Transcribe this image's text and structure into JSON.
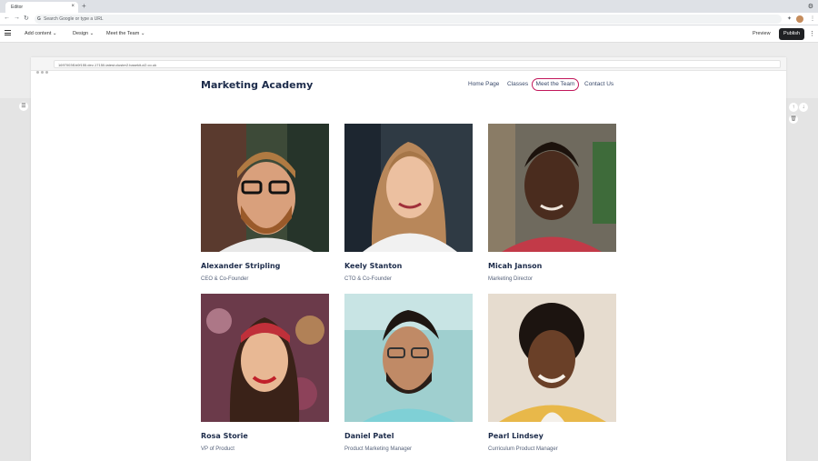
{
  "browser": {
    "tab_title": "Editor",
    "tab_close": "×",
    "new_tab": "+",
    "omnibox_placeholder": "Search Google or type a URL"
  },
  "editor": {
    "menus": [
      "Add content",
      "Design",
      "Meet the Team"
    ],
    "preview_label": "Preview",
    "publish_label": "Publish"
  },
  "frame": {
    "url": "1697003f1b0f155.dev-17150-latest.cluster2.basekit-ci2.co.uk"
  },
  "site": {
    "title": "Marketing Academy",
    "nav": [
      "Home Page",
      "Classes",
      "Meet the Team",
      "Contact Us"
    ],
    "active_nav": "Meet the Team",
    "active_color": "#c2185b"
  },
  "team": [
    {
      "name": "Alexander Stripling",
      "role": "CEO & Co-Founder"
    },
    {
      "name": "Keely Stanton",
      "role": "CTO & Co-Founder"
    },
    {
      "name": "Micah Janson",
      "role": "Marketing Director"
    },
    {
      "name": "Rosa Storie",
      "role": "VP of Product"
    },
    {
      "name": "Daniel Patel",
      "role": "Product Marketing Manager"
    },
    {
      "name": "Pearl Lindsey",
      "role": "Curriculum Product Manager"
    }
  ]
}
